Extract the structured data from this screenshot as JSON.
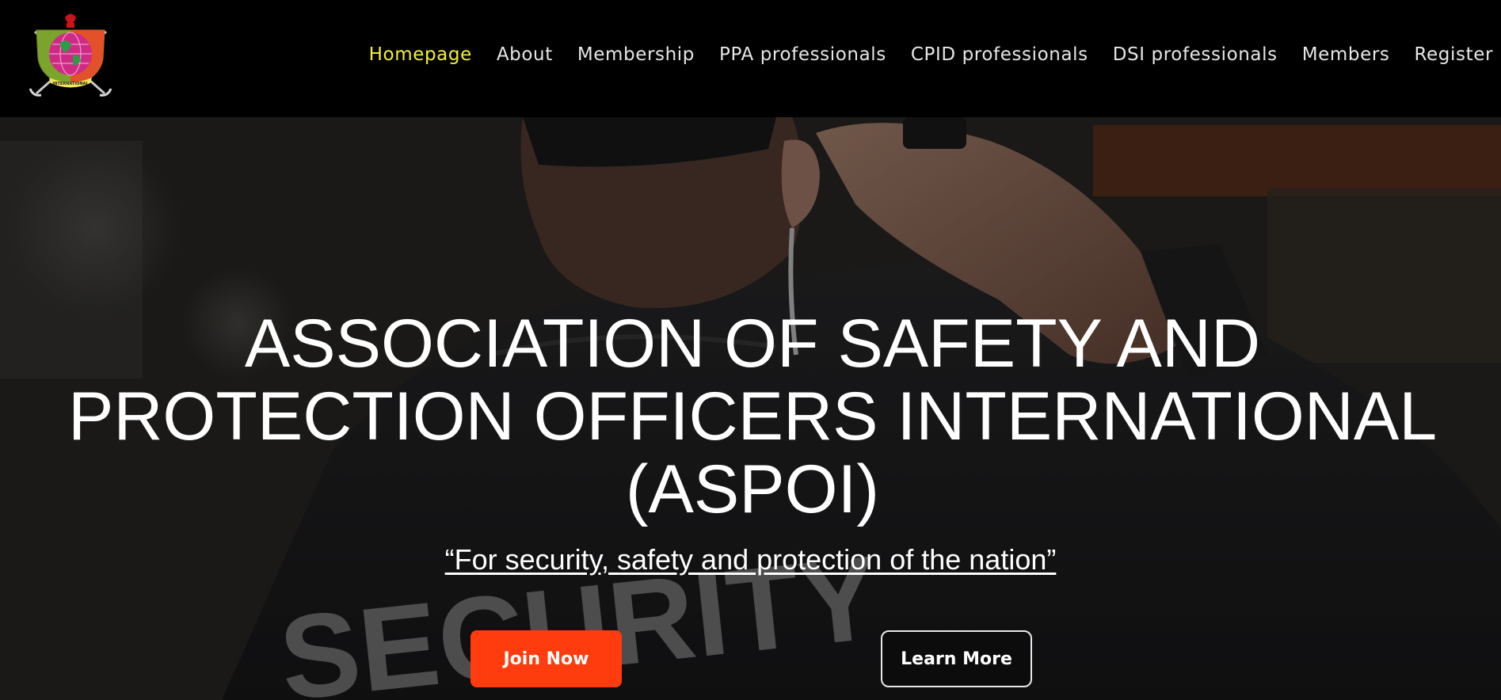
{
  "logo": {
    "ring_text": "SAFETY AND PROTECTION OFFICERS",
    "banner_text": "INTERNATIONAL"
  },
  "nav": {
    "items": [
      {
        "label": "Homepage",
        "active": true
      },
      {
        "label": "About",
        "active": false
      },
      {
        "label": "Membership",
        "active": false
      },
      {
        "label": "PPA professionals",
        "active": false
      },
      {
        "label": "CPID professionals",
        "active": false
      },
      {
        "label": "DSI professionals",
        "active": false
      },
      {
        "label": "Members",
        "active": false
      },
      {
        "label": "Register",
        "active": false
      }
    ]
  },
  "hero": {
    "title_line1": "ASSOCIATION OF SAFETY AND",
    "title_line2": "PROTECTION OFFICERS INTERNATIONAL",
    "title_line3": "(ASPOI)",
    "tagline": "“For security, safety and protection of the nation”",
    "photo_text": "SECURITY",
    "join_label": "Join Now",
    "learn_label": "Learn More"
  },
  "colors": {
    "active_nav": "#f4ef3a",
    "nav_text": "#e6e6e6",
    "join_button": "#ff3c0d",
    "header_bg": "#000000"
  }
}
